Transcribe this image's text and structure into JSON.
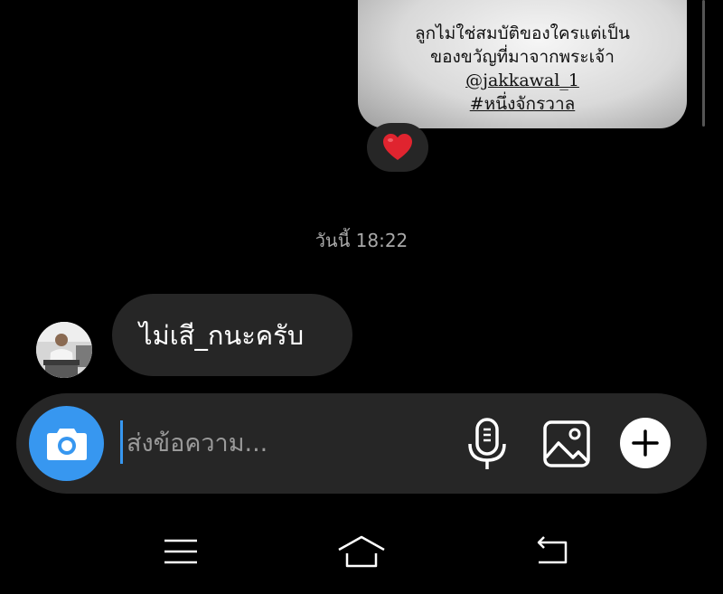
{
  "shared_post": {
    "lines": [
      "ลูกไม่ใช่สมบัติของใครแต่เป็น",
      "ของขวัญที่มาจากพระเจ้า",
      "@jakkawal_1",
      "#หนึ่งจักรวาล"
    ]
  },
  "reaction": {
    "emoji": "heart",
    "color": "#e0242f"
  },
  "timestamp": "วันนี้ 18:22",
  "incoming_message": {
    "text": "ไม่เสี_กนะครับ"
  },
  "composer": {
    "placeholder": "ส่งข้อความ...",
    "value": "",
    "camera_icon": "camera-icon",
    "mic_icon": "microphone-icon",
    "gallery_icon": "image-icon",
    "plus_icon": "plus-icon",
    "accent": "#3797f0"
  },
  "navbar": {
    "items": [
      "menu-icon",
      "home-icon",
      "back-icon"
    ]
  }
}
